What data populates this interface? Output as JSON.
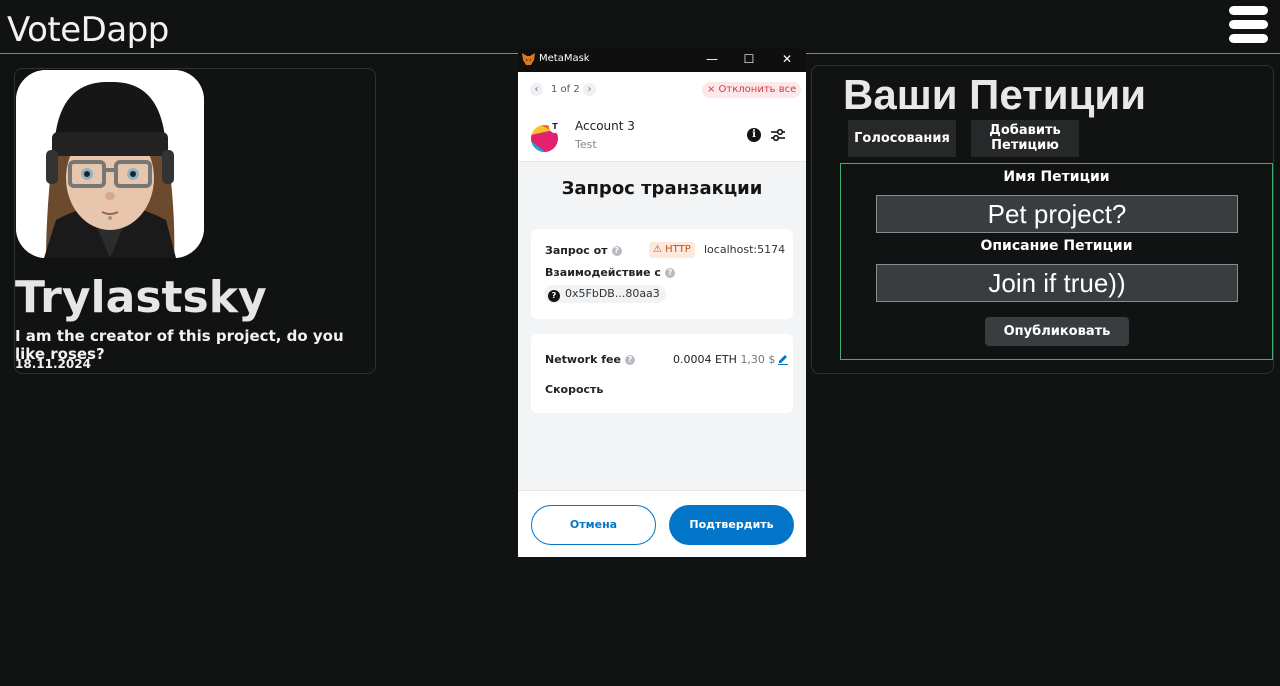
{
  "app": {
    "title": "VoteDapp"
  },
  "profile": {
    "name": "Trylastsky",
    "bio": "I am the creator of this project, do you like roses?",
    "date": "18.11.2024"
  },
  "petitions": {
    "title": "Ваши Петиции",
    "tabs": {
      "votes": "Голосования",
      "add_line1": "Добавить",
      "add_line2": "Петицию"
    },
    "form": {
      "name_label": "Имя Петиции",
      "name_value": "Pet project?",
      "description_label": "Описание Петиции",
      "description_value": "Join if true))",
      "publish_label": "Опубликовать"
    }
  },
  "metamask": {
    "window_title": "MetaMask",
    "pager": "1 of 2",
    "reject_all": "× Отклонить все",
    "account": {
      "name": "Account 3",
      "sub": "Test",
      "badge": "T"
    },
    "heading": "Запрос транзакции",
    "request": {
      "from_label": "Запрос от",
      "http_badge": "HTTP",
      "host": "localhost:5174",
      "interaction_label": "Взаимодействие с",
      "contract": "0x5FbDB...80aa3"
    },
    "fee": {
      "label": "Network fee",
      "eth": "0.0004 ETH",
      "usd": "1,30 $",
      "speed_label": "Скорость"
    },
    "buttons": {
      "cancel": "Отмена",
      "confirm": "Подтвердить"
    }
  },
  "colors": {
    "accent_green": "#3fae73",
    "metamask_blue": "#0376c9",
    "background": "#111212"
  }
}
